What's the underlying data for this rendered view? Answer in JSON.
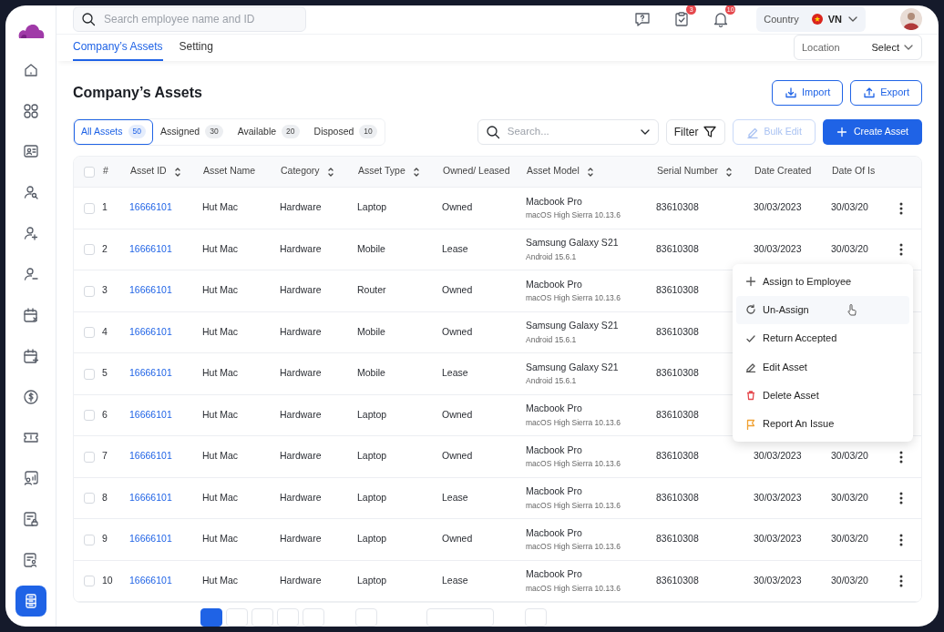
{
  "sidebar": {
    "items": [
      {
        "kind": "home",
        "selected": false
      },
      {
        "kind": "apps",
        "selected": false
      },
      {
        "kind": "id-card",
        "selected": false
      },
      {
        "kind": "user-search",
        "selected": false
      },
      {
        "kind": "user-plus",
        "selected": false
      },
      {
        "kind": "user-minus",
        "selected": false
      },
      {
        "kind": "calendar-x",
        "selected": false
      },
      {
        "kind": "calendar-plus",
        "selected": false
      },
      {
        "kind": "dollar",
        "selected": false
      },
      {
        "kind": "ticket",
        "selected": false
      },
      {
        "kind": "chart-user",
        "selected": false
      },
      {
        "kind": "doc-lock",
        "selected": false
      },
      {
        "kind": "doc-users",
        "selected": false
      },
      {
        "kind": "assets",
        "selected": true
      }
    ]
  },
  "topbar": {
    "search": {
      "placeholder": "Search employee name and ID"
    },
    "icons": [
      {
        "kind": "help"
      },
      {
        "kind": "tasks",
        "badge": "3"
      },
      {
        "kind": "bell",
        "badge": "10"
      }
    ],
    "country": {
      "label": "Country",
      "value": "VN"
    }
  },
  "tabs": [
    {
      "label": "Company’s Assets",
      "selected": true
    },
    {
      "label": "Setting",
      "selected": false
    }
  ],
  "location": {
    "label": "Location",
    "value": "Select"
  },
  "page_title": "Company’s Assets",
  "actions": [
    {
      "label": "Import",
      "kind": "import"
    },
    {
      "label": "Export",
      "kind": "export"
    }
  ],
  "filters": [
    {
      "label": "All Assets",
      "count": "50",
      "selected": true
    },
    {
      "label": "Assigned",
      "count": "30",
      "selected": false
    },
    {
      "label": "Available",
      "count": "20",
      "selected": false
    },
    {
      "label": "Disposed",
      "count": "10",
      "selected": false
    }
  ],
  "toolbar": {
    "search_placeholder": "Search...",
    "filter": "Filter",
    "bulk_edit": {
      "label": "Bulk Edit",
      "disabled": true
    },
    "create": "Create Asset"
  },
  "table": {
    "all_checked": false,
    "columns": [
      {
        "label": "#",
        "sortable": false
      },
      {
        "label": "Asset ID",
        "sortable": true
      },
      {
        "label": "Asset Name",
        "sortable": false
      },
      {
        "label": "Category",
        "sortable": true
      },
      {
        "label": "Asset Type",
        "sortable": true
      },
      {
        "label": "Owned/ Leased",
        "sortable": false
      },
      {
        "label": "Asset Model",
        "sortable": true
      },
      {
        "label": "Serial Number",
        "sortable": true
      },
      {
        "label": "Date Created",
        "sortable": false
      },
      {
        "label": "Date Of Is"
      }
    ],
    "rows": [
      {
        "checked": false,
        "no": "1",
        "id": "16666101",
        "name": "Hut Mac",
        "category": "Hardware",
        "type": "Laptop",
        "ownership": "Owned",
        "model": "Macbook Pro",
        "model_detail": "macOS High Sierra 10.13.6",
        "serial": "83610308",
        "date_created": "30/03/2023",
        "date_of_issue": "30/03/20",
        "menu": true
      },
      {
        "checked": false,
        "no": "2",
        "id": "16666101",
        "name": "Hut Mac",
        "category": "Hardware",
        "type": "Mobile",
        "ownership": "Lease",
        "model": "Samsung Galaxy S21",
        "model_detail": "Android 15.6.1",
        "serial": "83610308",
        "date_created": "30/03/2023",
        "date_of_issue": "30/03/20",
        "menu": true
      },
      {
        "checked": false,
        "no": "3",
        "id": "16666101",
        "name": "Hut Mac",
        "category": "Hardware",
        "type": "Router",
        "ownership": "Owned",
        "model": "Macbook Pro",
        "model_detail": "macOS High Sierra 10.13.6",
        "serial": "83610308",
        "menu": false
      },
      {
        "checked": false,
        "no": "4",
        "id": "16666101",
        "name": "Hut Mac",
        "category": "Hardware",
        "type": "Mobile",
        "ownership": "Owned",
        "model": "Samsung Galaxy S21",
        "model_detail": "Android 15.6.1",
        "serial": "83610308",
        "menu": false
      },
      {
        "checked": false,
        "no": "5",
        "id": "16666101",
        "name": "Hut Mac",
        "category": "Hardware",
        "type": "Mobile",
        "ownership": "Lease",
        "model": "Samsung Galaxy S21",
        "model_detail": "Android 15.6.1",
        "serial": "83610308",
        "menu": false
      },
      {
        "checked": false,
        "no": "6",
        "id": "16666101",
        "name": "Hut Mac",
        "category": "Hardware",
        "type": "Laptop",
        "ownership": "Owned",
        "model": "Macbook Pro",
        "model_detail": "macOS High Sierra 10.13.6",
        "serial": "83610308",
        "menu": false
      },
      {
        "checked": false,
        "no": "7",
        "id": "16666101",
        "name": "Hut Mac",
        "category": "Hardware",
        "type": "Laptop",
        "ownership": "Owned",
        "model": "Macbook Pro",
        "model_detail": "macOS High Sierra 10.13.6",
        "serial": "83610308",
        "date_created": "30/03/2023",
        "date_of_issue": "30/03/20",
        "menu": true
      },
      {
        "checked": false,
        "no": "8",
        "id": "16666101",
        "name": "Hut Mac",
        "category": "Hardware",
        "type": "Laptop",
        "ownership": "Lease",
        "model": "Macbook Pro",
        "model_detail": "macOS High Sierra 10.13.6",
        "serial": "83610308",
        "date_created": "30/03/2023",
        "date_of_issue": "30/03/20",
        "menu": true
      },
      {
        "checked": false,
        "no": "9",
        "id": "16666101",
        "name": "Hut Mac",
        "category": "Hardware",
        "type": "Laptop",
        "ownership": "Owned",
        "model": "Macbook Pro",
        "model_detail": "macOS High Sierra 10.13.6",
        "serial": "83610308",
        "date_created": "30/03/2023",
        "date_of_issue": "30/03/20",
        "menu": true
      },
      {
        "checked": false,
        "no": "10",
        "id": "16666101",
        "name": "Hut Mac",
        "category": "Hardware",
        "type": "Laptop",
        "ownership": "Lease",
        "model": "Macbook Pro",
        "model_detail": "macOS High Sierra 10.13.6",
        "serial": "83610308",
        "date_created": "30/03/2023",
        "date_of_issue": "30/03/20",
        "menu": true
      }
    ]
  },
  "context_menu": {
    "items": [
      {
        "label": "Assign to Employee",
        "kind": "plus",
        "highlighted": false
      },
      {
        "label": "Un-Assign",
        "kind": "refresh",
        "highlighted": true
      },
      {
        "label": "Return Accepted",
        "kind": "check",
        "highlighted": false
      },
      {
        "label": "Edit Asset",
        "kind": "pencil",
        "highlighted": false
      },
      {
        "label": "Delete Asset",
        "kind": "trash",
        "highlighted": false
      },
      {
        "label": "Report An Issue",
        "kind": "flag",
        "highlighted": false
      }
    ]
  },
  "pagination": [
    {
      "kind": "page",
      "selected": true
    },
    {
      "kind": "page",
      "selected": false
    },
    {
      "kind": "page",
      "selected": false
    },
    {
      "kind": "page",
      "selected": false
    },
    {
      "kind": "page",
      "selected": false
    },
    {
      "kind": "gap-page",
      "selected": false
    },
    {
      "kind": "wide",
      "selected": false
    },
    {
      "kind": "gap-page",
      "selected": false
    }
  ]
}
